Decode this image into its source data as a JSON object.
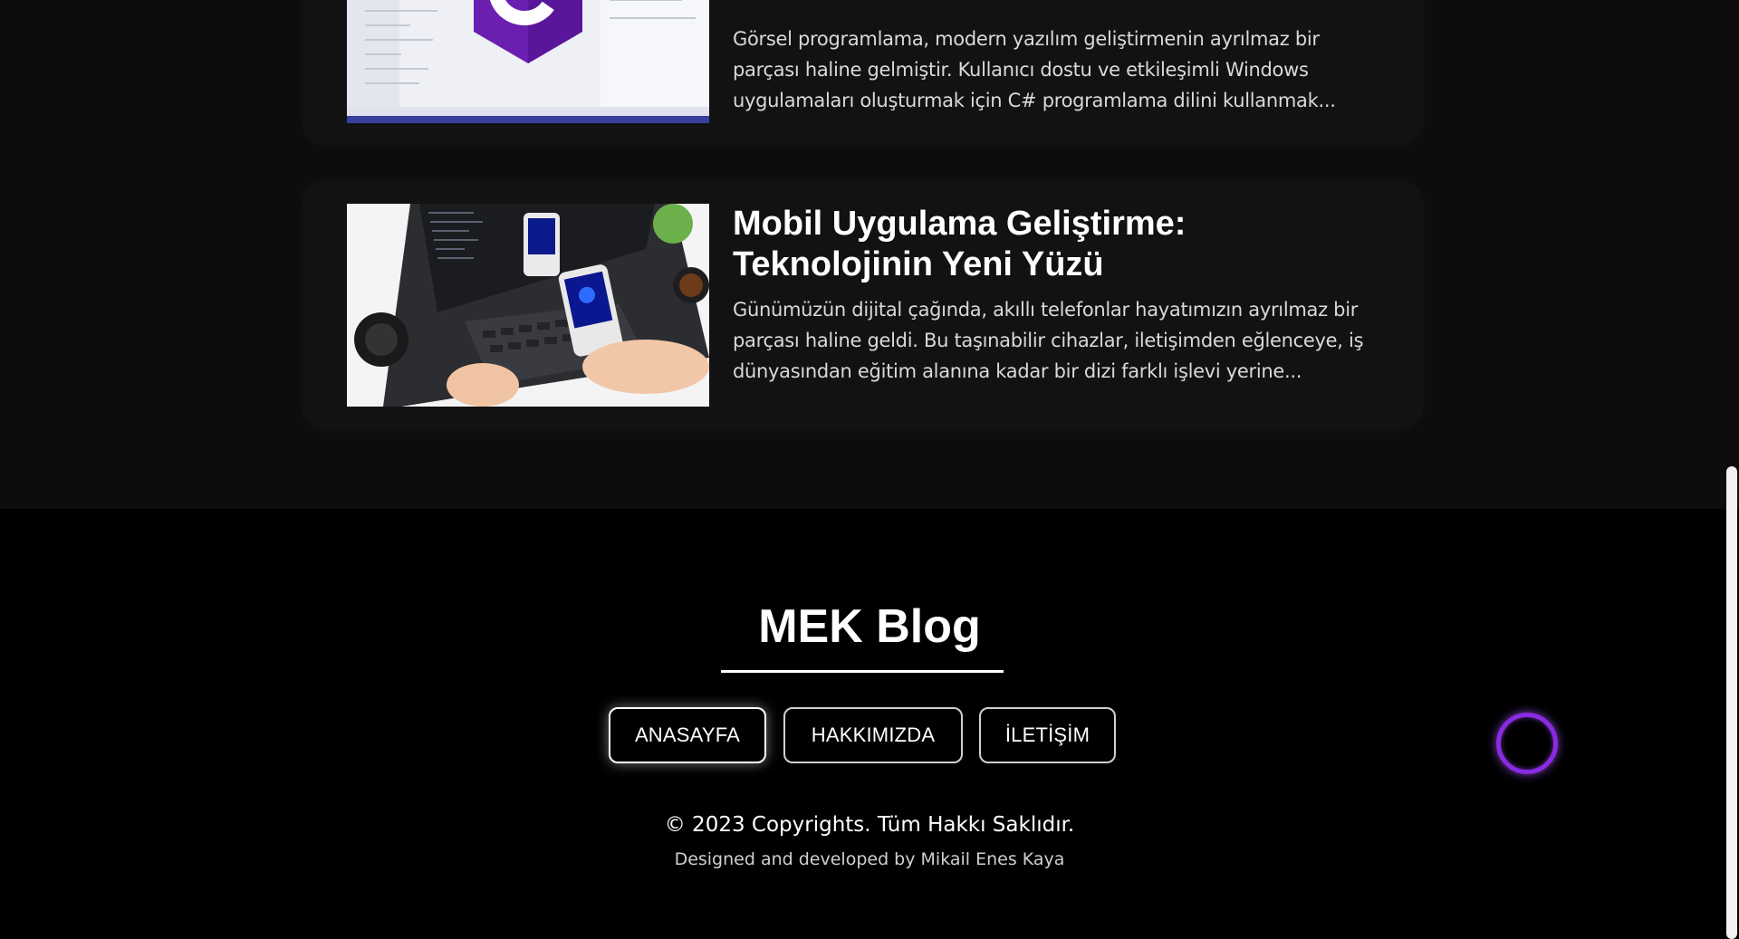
{
  "posts": [
    {
      "title": "",
      "excerpt": "Görsel programlama, modern yazılım geliştirmenin ayrılmaz bir parçası haline gelmiştir. Kullanıcı dostu ve etkileşimli Windows uygulamaları oluşturmak için C# programlama dilini kullanmak...",
      "thumb_label": "#"
    },
    {
      "title": "Mobil Uygulama Geliştirme: Teknolojinin Yeni Yüzü",
      "excerpt": "Günümüzün dijital çağında, akıllı telefonlar hayatımızın ayrılmaz bir parçası haline geldi. Bu taşınabilir cihazlar, iletişimden eğlenceye, iş dünyasından eğitim alanına kadar bir dizi farklı işlevi yerine..."
    }
  ],
  "footer": {
    "brand": "MEK Blog",
    "nav": [
      {
        "label": "ANASAYFA",
        "active": true
      },
      {
        "label": "HAKKIMIZDA",
        "active": false
      },
      {
        "label": "İLETİŞİM",
        "active": false
      }
    ],
    "copyright": "© 2023 Copyrights. Tüm Hakkı Saklıdır.",
    "credit": "Designed and developed by Mikail Enes Kaya"
  },
  "colors": {
    "page_bg": "#0d0d0d",
    "card_bg": "#121212",
    "footer_bg": "#000000",
    "accent_ring": "#8a2be2",
    "csharp_logo": "#6a1fb0"
  },
  "icons": {
    "floating_button": "circle-ring-icon",
    "csharp": "csharp-logo-icon"
  }
}
